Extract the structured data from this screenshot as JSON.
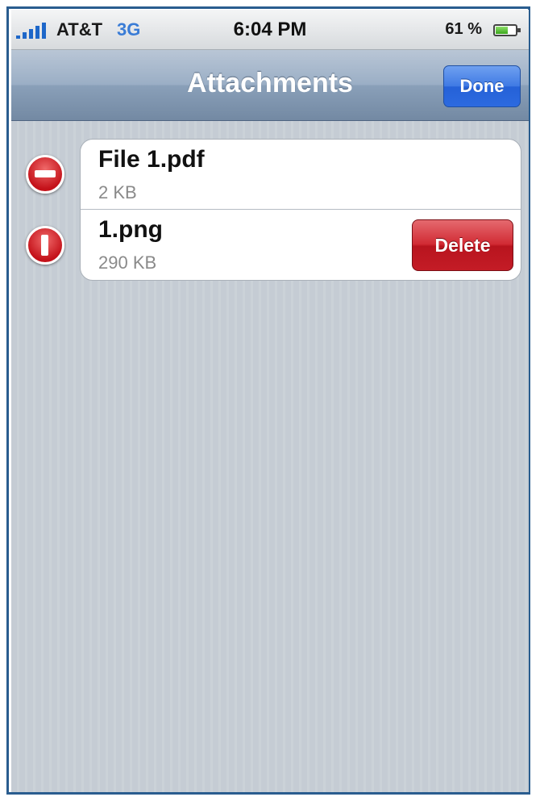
{
  "status_bar": {
    "carrier": "AT&T",
    "network": "3G",
    "time": "6:04 PM",
    "battery_percent": "61 %",
    "battery_level": 0.61
  },
  "nav_bar": {
    "title": "Attachments",
    "done_label": "Done"
  },
  "attachments": [
    {
      "name": "File 1.pdf",
      "size": "2 KB",
      "delete_label": ""
    },
    {
      "name": "1.png",
      "size": "290 KB",
      "delete_label": "Delete"
    }
  ],
  "colors": {
    "delete_red": "#c41c26",
    "done_blue": "#2c6ae0",
    "background_stripe": "#c5ccd4"
  }
}
